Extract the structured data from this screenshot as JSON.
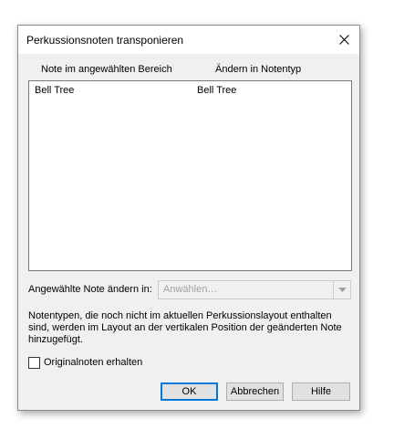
{
  "dialog": {
    "title": "Perkussionsnoten transponieren",
    "close_glyph": "✕"
  },
  "list": {
    "headers": [
      "Note im angewählten Bereich",
      "Ändern in Notentyp"
    ],
    "rows": [
      {
        "source": "Bell Tree",
        "target": "Bell Tree"
      }
    ]
  },
  "change_to": {
    "label": "Angewählte Note ändern in:",
    "placeholder": "Anwählen…",
    "enabled": false
  },
  "info": "Notentypen, die noch nicht im aktuellen Perkussionslayout enthalten sind, werden im Layout an der vertikalen Position der geänderten Note hinzugefügt.",
  "keep_original": {
    "label": "Originalnoten erhalten",
    "checked": false
  },
  "buttons": {
    "ok": "OK",
    "cancel": "Abbrechen",
    "help": "Hilfe"
  },
  "colors": {
    "dialog_bg": "#f0f0f0",
    "focus_border": "#0078d7",
    "disabled_text": "#a0a0a0"
  },
  "icons": {
    "close": "close-icon",
    "dropdown": "chevron-down-icon"
  }
}
